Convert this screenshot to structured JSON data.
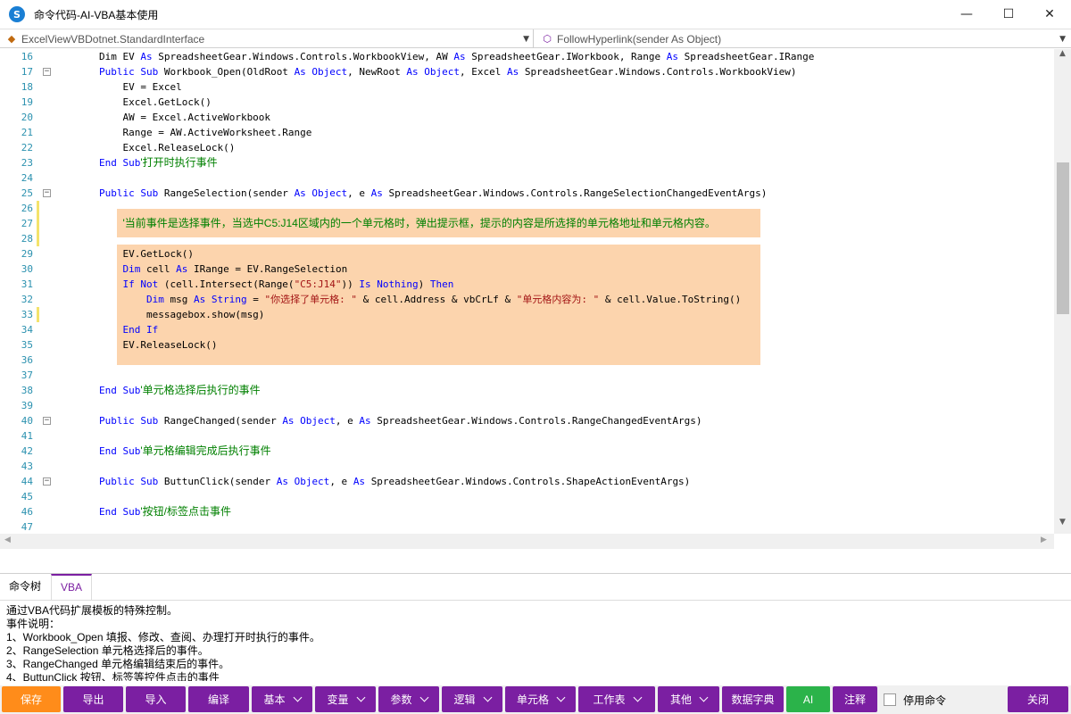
{
  "window": {
    "title": "命令代码-AI-VBA基本使用",
    "app_icon_text": "S",
    "minimize": "—",
    "maximize": "☐",
    "close": "✕"
  },
  "selectors": {
    "class_combo": {
      "value": "ExcelViewVBDotnet.StandardInterface",
      "icon": "class-icon"
    },
    "method_combo": {
      "value": "FollowHyperlink(sender As Object)",
      "icon": "method-icon"
    }
  },
  "editor": {
    "line_numbers": [
      "16",
      "17",
      "18",
      "19",
      "20",
      "21",
      "22",
      "23",
      "24",
      "25",
      "26",
      "27",
      "28",
      "29",
      "30",
      "31",
      "32",
      "33",
      "34",
      "35",
      "36",
      "37",
      "38",
      "39",
      "40",
      "41",
      "42",
      "43",
      "44",
      "45",
      "46",
      "47"
    ],
    "fold_lines": [
      "17",
      "25",
      "40",
      "44"
    ],
    "changed_lines": [
      "26",
      "27",
      "28",
      "33"
    ],
    "lines": [
      [
        {
          "t": "Dim EV ",
          "c": ""
        },
        {
          "t": "As ",
          "c": "kw"
        },
        {
          "t": "SpreadsheetGear.Windows.Controls.WorkbookView, AW ",
          "c": ""
        },
        {
          "t": "As ",
          "c": "kw"
        },
        {
          "t": "SpreadsheetGear.IWorkbook, Range ",
          "c": ""
        },
        {
          "t": "As ",
          "c": "kw"
        },
        {
          "t": "SpreadsheetGear.IRange",
          "c": ""
        }
      ],
      [
        {
          "t": "Public Sub ",
          "c": "kw"
        },
        {
          "t": "Workbook_Open(OldRoot ",
          "c": ""
        },
        {
          "t": "As Object",
          "c": "kw"
        },
        {
          "t": ", NewRoot ",
          "c": ""
        },
        {
          "t": "As Object",
          "c": "kw"
        },
        {
          "t": ", Excel ",
          "c": ""
        },
        {
          "t": "As ",
          "c": "kw"
        },
        {
          "t": "SpreadsheetGear.Windows.Controls.WorkbookView)",
          "c": ""
        }
      ],
      [
        {
          "t": "    EV = Excel",
          "c": ""
        }
      ],
      [
        {
          "t": "    Excel.GetLock()",
          "c": ""
        }
      ],
      [
        {
          "t": "    AW = Excel.ActiveWorkbook",
          "c": ""
        }
      ],
      [
        {
          "t": "    Range = AW.ActiveWorksheet.Range",
          "c": ""
        }
      ],
      [
        {
          "t": "    Excel.ReleaseLock()",
          "c": ""
        }
      ],
      [
        {
          "t": "End Sub",
          "c": "kw"
        },
        {
          "t": "'打开时执行事件",
          "c": "cm"
        }
      ],
      [],
      [
        {
          "t": "Public Sub ",
          "c": "kw"
        },
        {
          "t": "RangeSelection(sender ",
          "c": ""
        },
        {
          "t": "As Object",
          "c": "kw"
        },
        {
          "t": ", e ",
          "c": ""
        },
        {
          "t": "As ",
          "c": "kw"
        },
        {
          "t": "SpreadsheetGear.Windows.Controls.RangeSelectionChangedEventArgs)",
          "c": ""
        }
      ],
      [],
      [
        {
          "t": "    ",
          "c": ""
        },
        {
          "t": "'当前事件是选择事件，当选中C5:J14区域内的一个单元格时，弹出提示框，提示的内容是所选择的单元格地址和单元格内容。",
          "c": "cm"
        }
      ],
      [],
      [
        {
          "t": "    EV.GetLock()",
          "c": ""
        }
      ],
      [
        {
          "t": "    ",
          "c": ""
        },
        {
          "t": "Dim ",
          "c": "kw"
        },
        {
          "t": "cell ",
          "c": ""
        },
        {
          "t": "As ",
          "c": "kw"
        },
        {
          "t": "IRange = EV.RangeSelection",
          "c": ""
        }
      ],
      [
        {
          "t": "    ",
          "c": ""
        },
        {
          "t": "If Not ",
          "c": "kw"
        },
        {
          "t": "(cell.Intersect(Range(",
          "c": ""
        },
        {
          "t": "\"C5:J14\"",
          "c": "st"
        },
        {
          "t": ")) ",
          "c": ""
        },
        {
          "t": "Is Nothing",
          "c": "kw"
        },
        {
          "t": ") ",
          "c": ""
        },
        {
          "t": "Then",
          "c": "kw"
        }
      ],
      [
        {
          "t": "        ",
          "c": ""
        },
        {
          "t": "Dim ",
          "c": "kw"
        },
        {
          "t": "msg ",
          "c": ""
        },
        {
          "t": "As String",
          "c": "kw"
        },
        {
          "t": " = ",
          "c": ""
        },
        {
          "t": "\"你选择了单元格: \"",
          "c": "st"
        },
        {
          "t": " & cell.Address & vbCrLf & ",
          "c": ""
        },
        {
          "t": "\"单元格内容为: \"",
          "c": "st"
        },
        {
          "t": " & cell.Value.ToString()",
          "c": ""
        }
      ],
      [
        {
          "t": "        messagebox.show(msg)",
          "c": ""
        }
      ],
      [
        {
          "t": "    ",
          "c": ""
        },
        {
          "t": "End If",
          "c": "kw"
        }
      ],
      [
        {
          "t": "    EV.ReleaseLock()",
          "c": ""
        }
      ],
      [],
      [],
      [
        {
          "t": "End Sub",
          "c": "kw"
        },
        {
          "t": "'单元格选择后执行的事件",
          "c": "cm"
        }
      ],
      [],
      [
        {
          "t": "Public Sub ",
          "c": "kw"
        },
        {
          "t": "RangeChanged(sender ",
          "c": ""
        },
        {
          "t": "As Object",
          "c": "kw"
        },
        {
          "t": ", e ",
          "c": ""
        },
        {
          "t": "As ",
          "c": "kw"
        },
        {
          "t": "SpreadsheetGear.Windows.Controls.RangeChangedEventArgs)",
          "c": ""
        }
      ],
      [],
      [
        {
          "t": "End Sub",
          "c": "kw"
        },
        {
          "t": "'单元格编辑完成后执行事件",
          "c": "cm"
        }
      ],
      [],
      [
        {
          "t": "Public Sub ",
          "c": "kw"
        },
        {
          "t": "ButtunClick(sender ",
          "c": ""
        },
        {
          "t": "As Object",
          "c": "kw"
        },
        {
          "t": ", e ",
          "c": ""
        },
        {
          "t": "As ",
          "c": "kw"
        },
        {
          "t": "SpreadsheetGear.Windows.Controls.ShapeActionEventArgs)",
          "c": ""
        }
      ],
      [],
      [
        {
          "t": "End Sub",
          "c": "kw"
        },
        {
          "t": "'按钮/标签点击事件",
          "c": "cm"
        }
      ],
      []
    ]
  },
  "bottom_tabs": [
    {
      "label": "命令树"
    },
    {
      "label": "VBA"
    }
  ],
  "description": [
    "通过VBA代码扩展模板的特殊控制。",
    "事件说明：",
    "1、Workbook_Open 填报、修改、查阅、办理打开时执行的事件。",
    "2、RangeSelection 单元格选择后的事件。",
    "3、RangeChanged 单元格编辑结束后的事件。",
    "4、ButtunClick 按钮、标签等控件点击的事件"
  ],
  "toolbar": {
    "save": "保存",
    "export": "导出",
    "import": "导入",
    "compile": "编译",
    "basic": "基本",
    "variable": "变量",
    "param": "参数",
    "logic": "逻辑",
    "cell": "单元格",
    "worksheet": "工作表",
    "other": "其他",
    "dictionary": "数据字典",
    "ai": "AI",
    "comment": "注释",
    "disable_cmd": "停用命令",
    "close": "关闭"
  },
  "colors": {
    "accent": "#7b1fa2",
    "save": "#ff8c1a",
    "ai": "#2bb34a",
    "highlight": "#fcd4ad",
    "keyword": "#0000ff",
    "comment": "#008000",
    "string": "#a31515",
    "line_number": "#2b91af"
  }
}
